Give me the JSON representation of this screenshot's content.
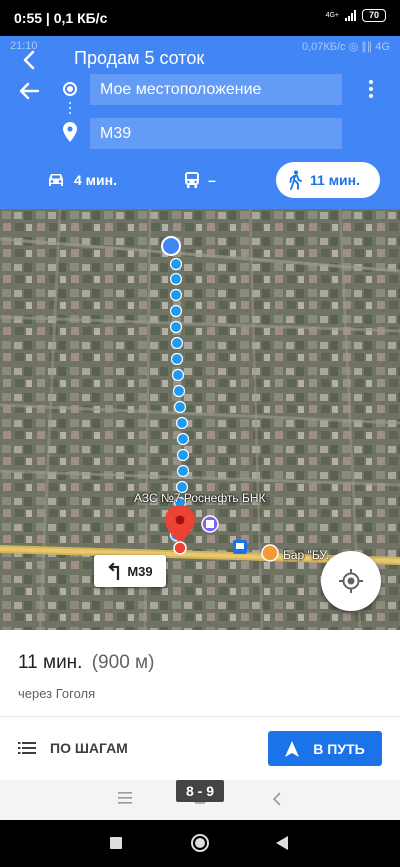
{
  "outer_status": {
    "time_speed": "0:55 | 0,1 КБ/с",
    "network": "4G+",
    "battery": "70"
  },
  "ghost_status": {
    "time": "21:10",
    "info": "0,07КБ/с  ◎  ∥∥  4G"
  },
  "header": {
    "title": "Продам 5 соток",
    "origin_value": "Мое местоположение",
    "destination_value": "М39"
  },
  "modes": {
    "car_label": "4 мин.",
    "transit_label": "–",
    "walk_label": "11 мин."
  },
  "map": {
    "poi_label": "АЗС №7 Роснефть БНК",
    "bar_label": "Бар \"БУ...",
    "street_sign": "М39"
  },
  "route": {
    "duration": "11 мин.",
    "distance": "(900 м)",
    "via": "через Гоголя",
    "steps_label": "ПО ШАГАМ",
    "go_label": "В ПУТЬ"
  },
  "app_nav": {
    "page_badge": "8 - 9"
  },
  "colors": {
    "header_blue": "#4285f4",
    "route_dot": "#1e9bf0",
    "go_button": "#1a73e8",
    "pin_red": "#ea4335"
  },
  "icons": [
    "back-arrow-icon",
    "origin-dot-icon",
    "destination-pin-icon",
    "more-vert-icon",
    "car-icon",
    "bus-icon",
    "walk-icon",
    "my-location-icon",
    "turn-left-icon",
    "list-icon",
    "navigation-arrow-icon"
  ]
}
